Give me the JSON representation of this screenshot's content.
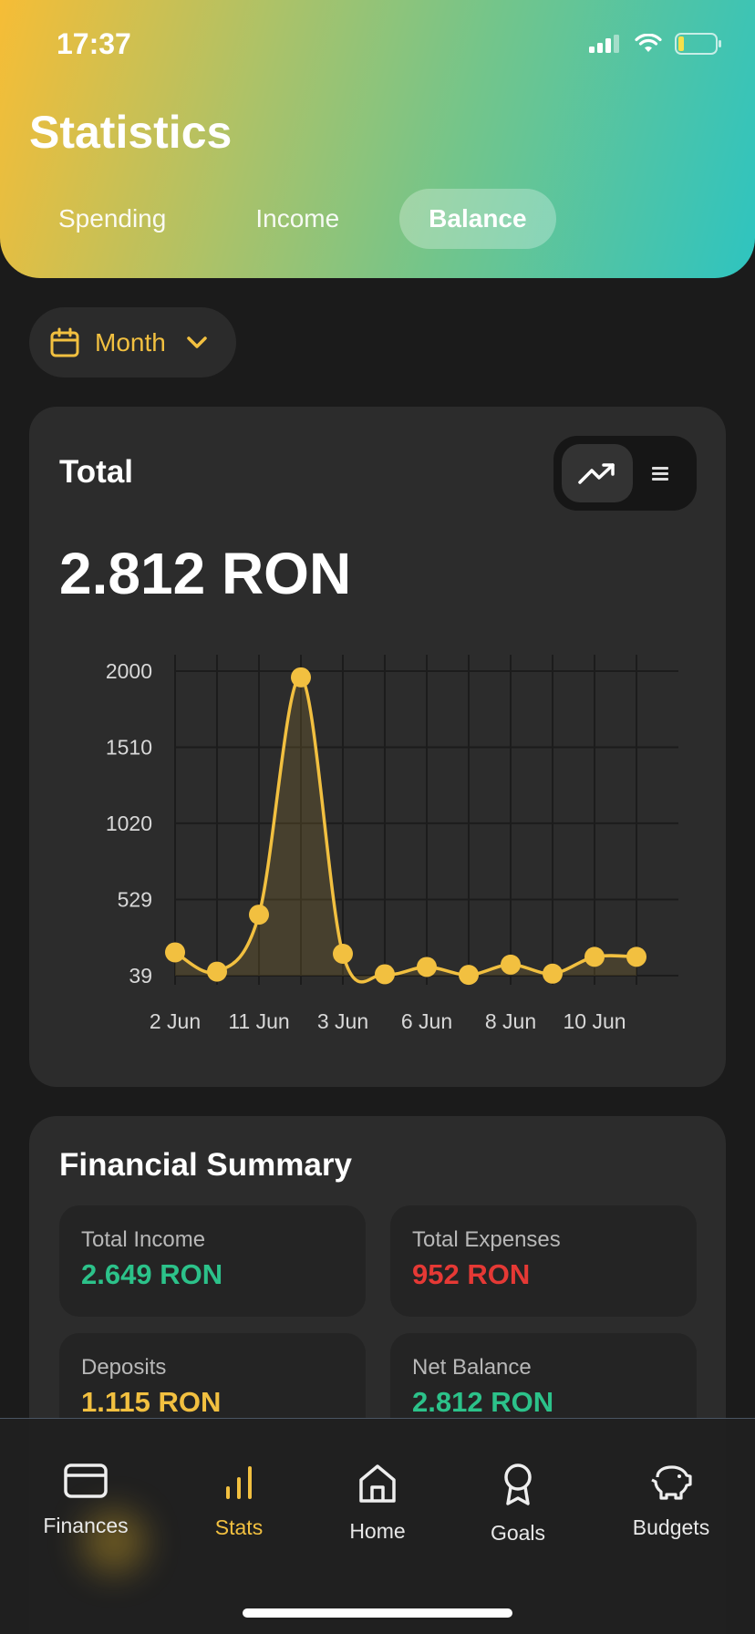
{
  "status_bar": {
    "time": "17:37"
  },
  "header": {
    "title": "Statistics",
    "tabs": [
      {
        "label": "Spending",
        "active": false
      },
      {
        "label": "Income",
        "active": false
      },
      {
        "label": "Balance",
        "active": true
      }
    ]
  },
  "period_selector": {
    "label": "Month",
    "icon": "calendar-icon",
    "dropdown_icon": "chevron-down-icon"
  },
  "total_card": {
    "title": "Total",
    "value": "2.812 RON",
    "view_toggle": {
      "options": [
        "trend-icon",
        "list-icon"
      ],
      "selected": "trend-icon"
    }
  },
  "chart_data": {
    "type": "area",
    "categories": [
      "2 Jun",
      "",
      "11 Jun",
      "",
      "3 Jun",
      "",
      "6 Jun",
      "",
      "8 Jun",
      "",
      "10 Jun",
      ""
    ],
    "x_tick_labels": [
      "2 Jun",
      "11 Jun",
      "3 Jun",
      "6 Jun",
      "8 Jun",
      "10 Jun"
    ],
    "values": [
      189,
      65,
      432,
      1960,
      180,
      48,
      95,
      44,
      110,
      52,
      160,
      160
    ],
    "y_ticks": [
      39,
      529,
      1020,
      1510,
      2000
    ],
    "ylim": [
      39,
      2000
    ],
    "grid": true,
    "color": "#f2c040"
  },
  "summary": {
    "title": "Financial Summary",
    "items": [
      {
        "label": "Total Income",
        "value": "2.649 RON",
        "color": "#2cc28a"
      },
      {
        "label": "Total Expenses",
        "value": "952 RON",
        "color": "#e53935"
      },
      {
        "label": "Deposits",
        "value": "1.115 RON",
        "color": "#f2c040"
      },
      {
        "label": "Net Balance",
        "value": "2.812 RON",
        "color": "#2cc28a"
      }
    ]
  },
  "bottom_nav": {
    "items": [
      {
        "label": "Finances",
        "icon": "card-icon",
        "active": false
      },
      {
        "label": "Stats",
        "icon": "bar-chart-icon",
        "active": true
      },
      {
        "label": "Home",
        "icon": "home-icon",
        "active": false
      },
      {
        "label": "Goals",
        "icon": "award-icon",
        "active": false
      },
      {
        "label": "Budgets",
        "icon": "piggy-bank-icon",
        "active": false
      }
    ]
  }
}
